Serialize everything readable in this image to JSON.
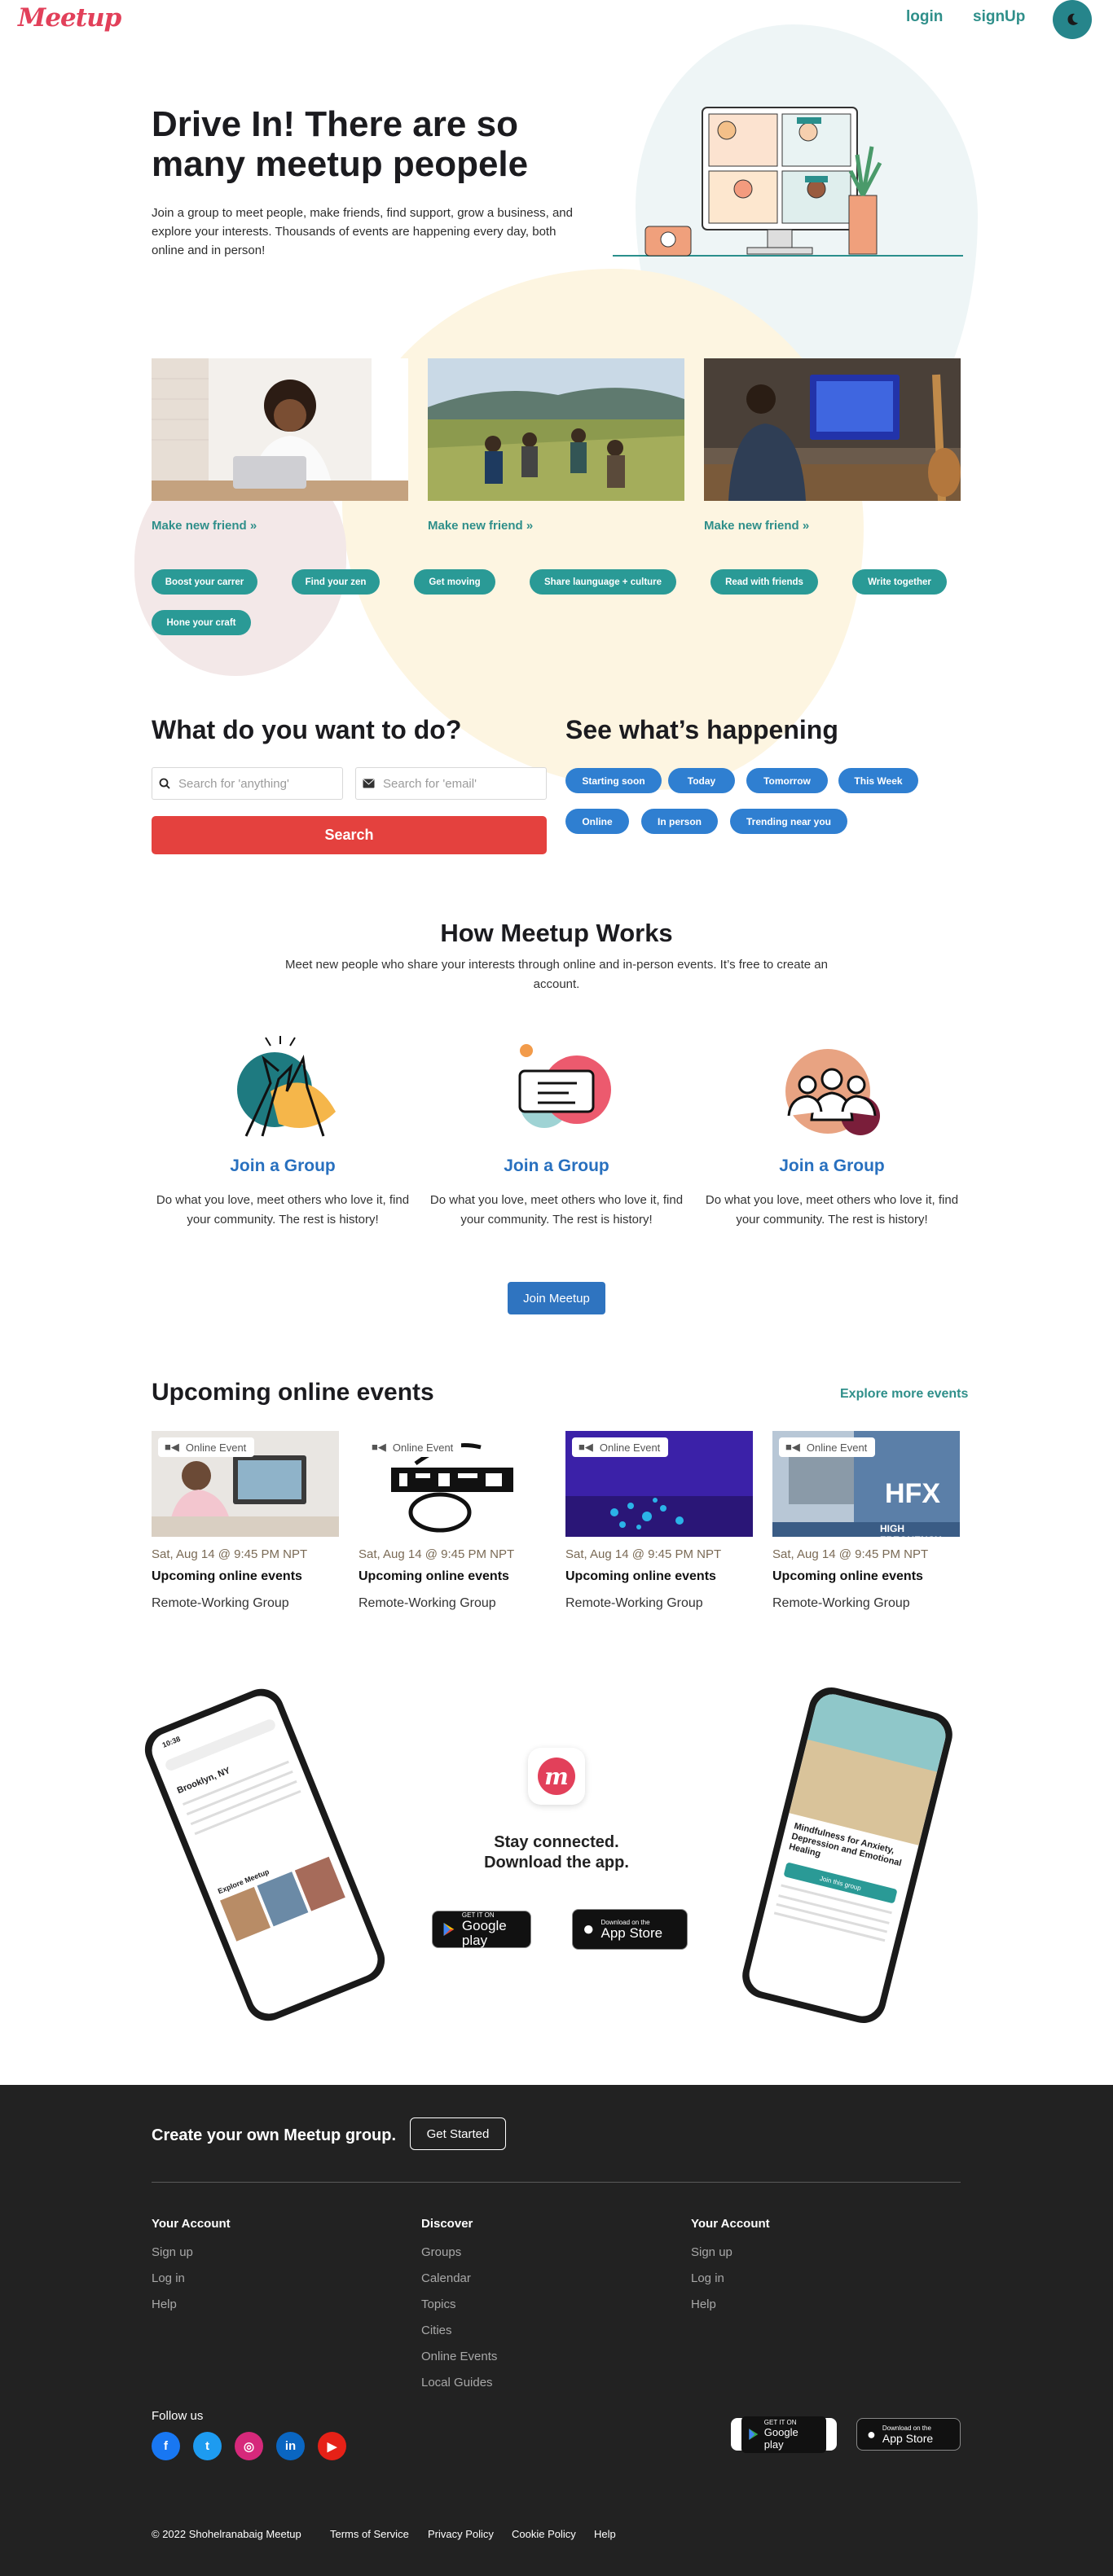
{
  "header": {
    "logo": "Meetup",
    "login": "login",
    "signup": "signUp",
    "theme_icon": "moon-icon"
  },
  "hero": {
    "title": "Drive In! There are so many meetup peopele",
    "description": "Join a group to meet people, make friends, find support, grow a business, and explore your interests. Thousands of events are happening every day, both online and in person!"
  },
  "friends": [
    {
      "label": "Make new friend"
    },
    {
      "label": "Make new friend"
    },
    {
      "label": "Make new friend"
    }
  ],
  "topics": [
    "Boost your carrer",
    "Find your zen",
    "Get moving",
    "Share launguage + culture",
    "Read with friends",
    "Write together",
    "Hone your craft"
  ],
  "search": {
    "title": "What do you want to do?",
    "anything_placeholder": "Search for 'anything'",
    "email_placeholder": "Search for 'email'",
    "button": "Search"
  },
  "happening": {
    "title": "See what’s happening",
    "filters": [
      "Starting soon",
      "Today",
      "Tomorrow",
      "This Week",
      "Online",
      "In person",
      "Trending near you"
    ]
  },
  "how": {
    "title": "How Meetup Works",
    "description": "Meet new people who share your interests through online and in-person events. It’s free to create an account.",
    "steps": [
      {
        "title": "Join a Group",
        "text": "Do what you love, meet others who love it, find your community. The rest is history!"
      },
      {
        "title": "Join a Group",
        "text": "Do what you love, meet others who love it, find your community. The rest is history!"
      },
      {
        "title": "Join a Group",
        "text": "Do what you love, meet others who love it, find your community. The rest is history!"
      }
    ],
    "button": "Join Meetup"
  },
  "events": {
    "title": "Upcoming online events",
    "explore": "Explore more events",
    "items": [
      {
        "badge": "Online Event",
        "date": "Sat, Aug 14 @ 9:45 PM NPT",
        "title": "Upcoming online events",
        "group": "Remote-Working Group"
      },
      {
        "badge": "Online Event",
        "date": "Sat, Aug 14 @ 9:45 PM NPT",
        "title": "Upcoming online events",
        "group": "Remote-Working Group"
      },
      {
        "badge": "Online Event",
        "date": "Sat, Aug 14 @ 9:45 PM NPT",
        "title": "Upcoming online events",
        "group": "Remote-Working Group"
      },
      {
        "badge": "Online Event",
        "date": "Sat, Aug 14 @ 9:45 PM NPT",
        "title": "Upcoming online events",
        "group": "Remote-Working Group"
      }
    ],
    "hfx_text": "HFX",
    "hfx_sub": "HIGH FREQUENCY"
  },
  "app": {
    "title_line1": "Stay connected.",
    "title_line2": "Download the app.",
    "google_small": "GET IT ON",
    "google_big": "Google play",
    "apple_small": "Download on the",
    "apple_big": "App Store",
    "phone_left": {
      "time": "10:38",
      "heading": "Brooklyn, NY",
      "explore": "Explore Meetup"
    },
    "phone_right": {
      "title": "Mindfulness for Anxiety, Depression and Emotional Healing",
      "cta": "Join this group"
    }
  },
  "footer": {
    "cta": "Create your own Meetup group.",
    "get_started": "Get Started",
    "columns": [
      {
        "title": "Your Account",
        "links": [
          "Sign up",
          "Log in",
          "Help"
        ]
      },
      {
        "title": "Discover",
        "links": [
          "Groups",
          "Calendar",
          "Topics",
          "Cities",
          "Online Events",
          "Local Guides"
        ]
      },
      {
        "title": "Your Account",
        "links": [
          "Sign up",
          "Log in",
          "Help"
        ]
      }
    ],
    "follow": "Follow us",
    "social": [
      {
        "name": "facebook-icon",
        "glyph": "f",
        "color": "#1877f2"
      },
      {
        "name": "twitter-icon",
        "glyph": "t",
        "color": "#1d9bf0"
      },
      {
        "name": "instagram-icon",
        "glyph": "◎",
        "color": "#d6297b"
      },
      {
        "name": "linkedin-icon",
        "glyph": "in",
        "color": "#0a66c2"
      },
      {
        "name": "youtube-icon",
        "glyph": "▶",
        "color": "#e62117"
      }
    ],
    "copyright": "© 2022 Shohelranabaig Meetup",
    "legal": [
      "Terms of Service",
      "Privacy Policy",
      "Cookie Policy",
      "Help"
    ]
  },
  "colors": {
    "brand": "#e2405a",
    "teal": "#2a9a96",
    "blue": "#2f7fd1",
    "red_button": "#e4413e",
    "footer_bg": "#222222"
  }
}
